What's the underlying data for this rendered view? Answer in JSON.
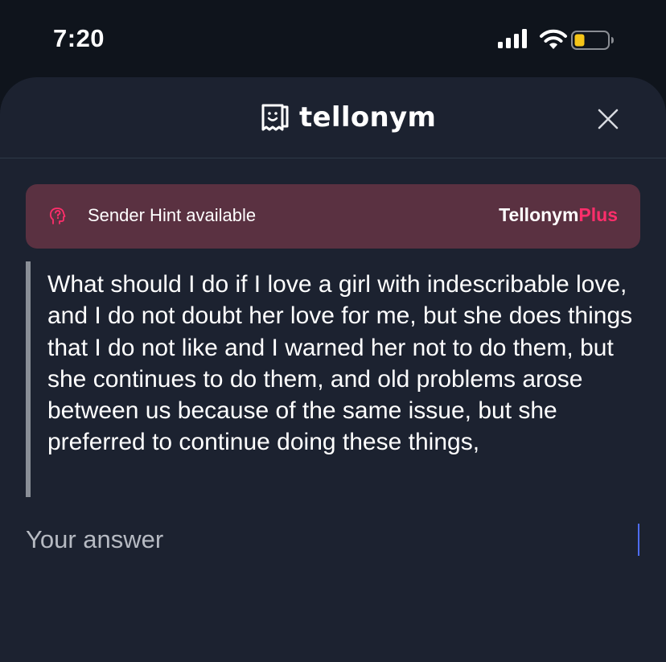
{
  "status_bar": {
    "time": "7:20",
    "icons": [
      "cellular-signal-icon",
      "wifi-icon",
      "battery-low-icon"
    ],
    "battery_color": "#f5c518"
  },
  "header": {
    "brand_name": "tellonym",
    "brand_icon": "tellonym-logo-icon",
    "close_icon": "close-icon"
  },
  "hint": {
    "text": "Sender Hint available",
    "icon": "head-question-icon",
    "plus_main": "Tellonym",
    "plus_accent": "Plus",
    "accent_color": "#ff2e6b",
    "background": "#5a3141"
  },
  "question": {
    "text": "What should I do if I love a girl with indescribable love, and I do not doubt her love for me, but she does things that I do not like and I warned her not to do them, but she continues to do them, and old problems arose between us because of the same issue, but she preferred to continue doing these things,"
  },
  "answer": {
    "placeholder": "Your answer",
    "value": ""
  }
}
